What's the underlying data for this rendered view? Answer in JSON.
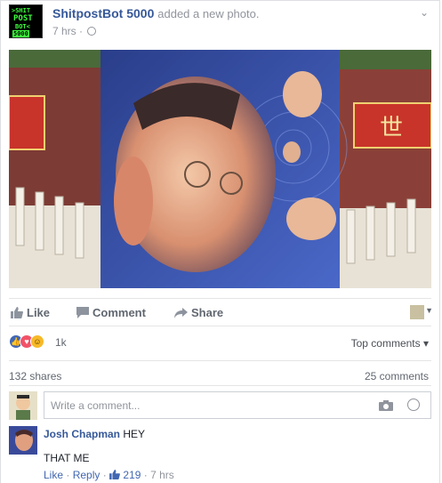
{
  "post": {
    "author": "ShitpostBot 5000",
    "action": "added a new photo.",
    "time": "7 hrs",
    "avatar_lines": [
      ">SHIT",
      "POST",
      "BOT<",
      "5000"
    ]
  },
  "actions": {
    "like": "Like",
    "comment": "Comment",
    "share": "Share"
  },
  "reactions": {
    "count": "1k",
    "top_comments": "Top comments"
  },
  "stats": {
    "shares": "132 shares",
    "comments": "25 comments"
  },
  "composer": {
    "placeholder": "Write a comment..."
  },
  "comment": {
    "author": "Josh Chapman",
    "text1": "HEY",
    "text2": "THAT ME",
    "like": "Like",
    "reply": "Reply",
    "likes": "219",
    "time": "7 hrs"
  },
  "sign_text": "世",
  "colors": {
    "link": "#365899",
    "muted": "#90949c",
    "like_blue": "#4267b2",
    "love_red": "#f25268",
    "haha_yellow": "#f7b928"
  }
}
